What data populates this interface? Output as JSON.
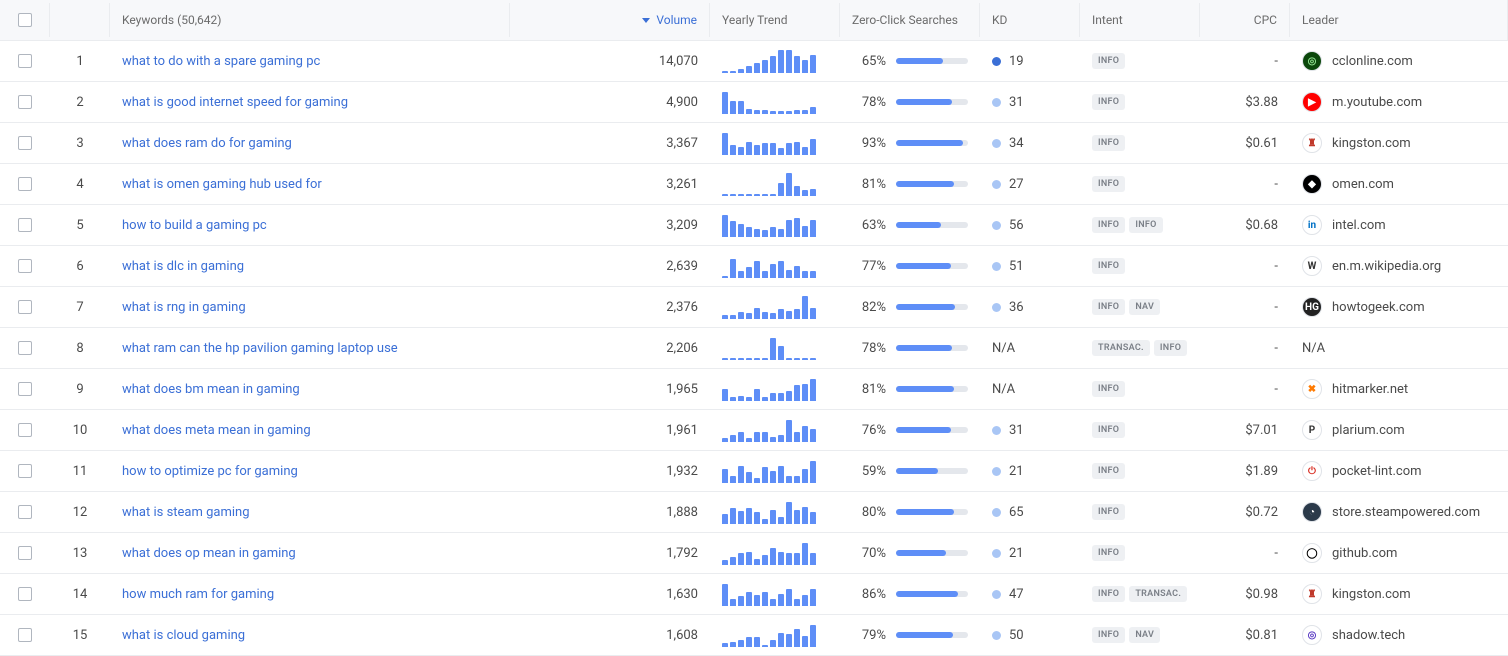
{
  "header": {
    "keywords_label": "Keywords (50,642)",
    "volume_label": "Volume",
    "trend_label": "Yearly Trend",
    "zeroclick_label": "Zero-Click Searches",
    "kd_label": "KD",
    "intent_label": "Intent",
    "cpc_label": "CPC",
    "leader_label": "Leader"
  },
  "rows": [
    {
      "idx": "1",
      "keyword": "what to do with a spare gaming pc",
      "volume": "14,070",
      "trend": [
        10,
        10,
        15,
        30,
        40,
        55,
        70,
        95,
        95,
        70,
        55,
        75
      ],
      "zc_pct": "65%",
      "zc_val": 65,
      "kd": "19",
      "kd_color": "#3b6fd6",
      "intent": [
        "INFO"
      ],
      "cpc": "-",
      "leader": "cclonline.com",
      "fav_bg": "#0b470b",
      "fav_fg": "#8fe08f",
      "fav_txt": "◎"
    },
    {
      "idx": "2",
      "keyword": "what is good internet speed for gaming",
      "volume": "4,900",
      "trend": [
        90,
        55,
        55,
        20,
        15,
        15,
        12,
        12,
        12,
        15,
        15,
        30
      ],
      "zc_pct": "78%",
      "zc_val": 78,
      "kd": "31",
      "kd_color": "#a9c6f5",
      "intent": [
        "INFO"
      ],
      "cpc": "$3.88",
      "leader": "m.youtube.com",
      "fav_bg": "#ff0000",
      "fav_fg": "#fff",
      "fav_txt": "▶"
    },
    {
      "idx": "3",
      "keyword": "what does ram do for gaming",
      "volume": "3,367",
      "trend": [
        90,
        40,
        35,
        55,
        40,
        50,
        50,
        30,
        50,
        55,
        35,
        65
      ],
      "zc_pct": "93%",
      "zc_val": 93,
      "kd": "34",
      "kd_color": "#a9c6f5",
      "intent": [
        "INFO"
      ],
      "cpc": "$0.61",
      "leader": "kingston.com",
      "fav_bg": "#fff",
      "fav_fg": "#c0392b",
      "fav_txt": "♜"
    },
    {
      "idx": "4",
      "keyword": "what is omen gaming hub used for",
      "volume": "3,261",
      "trend": [
        5,
        5,
        5,
        5,
        5,
        8,
        10,
        55,
        95,
        40,
        25,
        30
      ],
      "zc_pct": "81%",
      "zc_val": 81,
      "kd": "27",
      "kd_color": "#a9c6f5",
      "intent": [
        "INFO"
      ],
      "cpc": "-",
      "leader": "omen.com",
      "fav_bg": "#000",
      "fav_fg": "#fff",
      "fav_txt": "◆"
    },
    {
      "idx": "5",
      "keyword": "how to build a gaming pc",
      "volume": "3,209",
      "trend": [
        90,
        65,
        55,
        40,
        35,
        30,
        40,
        35,
        70,
        80,
        45,
        70
      ],
      "zc_pct": "63%",
      "zc_val": 63,
      "kd": "56",
      "kd_color": "#a9c6f5",
      "intent": [
        "INFO",
        "INFO"
      ],
      "cpc": "$0.68",
      "leader": "intel.com",
      "fav_bg": "#fff",
      "fav_fg": "#0071c5",
      "fav_txt": "in"
    },
    {
      "idx": "6",
      "keyword": "what is dlc in gaming",
      "volume": "2,639",
      "trend": [
        10,
        80,
        30,
        45,
        70,
        30,
        60,
        70,
        35,
        50,
        30,
        30
      ],
      "zc_pct": "77%",
      "zc_val": 77,
      "kd": "51",
      "kd_color": "#a9c6f5",
      "intent": [
        "INFO"
      ],
      "cpc": "-",
      "leader": "en.m.wikipedia.org",
      "fav_bg": "#fff",
      "fav_fg": "#333",
      "fav_txt": "W"
    },
    {
      "idx": "7",
      "keyword": "what is rng in gaming",
      "volume": "2,376",
      "trend": [
        15,
        15,
        30,
        25,
        45,
        30,
        25,
        40,
        35,
        40,
        95,
        45
      ],
      "zc_pct": "82%",
      "zc_val": 82,
      "kd": "36",
      "kd_color": "#a9c6f5",
      "intent": [
        "INFO",
        "NAV"
      ],
      "cpc": "-",
      "leader": "howtogeek.com",
      "fav_bg": "#222",
      "fav_fg": "#fff",
      "fav_txt": "HG"
    },
    {
      "idx": "8",
      "keyword": "what ram can the hp pavilion gaming laptop use",
      "volume": "2,206",
      "trend": [
        8,
        8,
        8,
        8,
        8,
        10,
        90,
        60,
        10,
        10,
        8,
        8
      ],
      "zc_pct": "78%",
      "zc_val": 78,
      "kd": "N/A",
      "kd_color": "",
      "intent": [
        "TRANSAC.",
        "INFO"
      ],
      "cpc": "-",
      "leader": "N/A",
      "fav_bg": "",
      "fav_fg": "",
      "fav_txt": ""
    },
    {
      "idx": "9",
      "keyword": "what does bm mean in gaming",
      "volume": "1,965",
      "trend": [
        50,
        15,
        20,
        15,
        50,
        15,
        35,
        35,
        40,
        65,
        70,
        90
      ],
      "zc_pct": "81%",
      "zc_val": 81,
      "kd": "N/A",
      "kd_color": "",
      "intent": [
        "INFO"
      ],
      "cpc": "-",
      "leader": "hitmarker.net",
      "fav_bg": "#fff",
      "fav_fg": "#ff7a00",
      "fav_txt": "✖"
    },
    {
      "idx": "10",
      "keyword": "what does meta mean in gaming",
      "volume": "1,961",
      "trend": [
        15,
        30,
        40,
        15,
        40,
        40,
        20,
        30,
        90,
        40,
        65,
        55
      ],
      "zc_pct": "76%",
      "zc_val": 76,
      "kd": "31",
      "kd_color": "#a9c6f5",
      "intent": [
        "INFO"
      ],
      "cpc": "$7.01",
      "leader": "plarium.com",
      "fav_bg": "#fff",
      "fav_fg": "#333",
      "fav_txt": "P"
    },
    {
      "idx": "11",
      "keyword": "how to optimize pc for gaming",
      "volume": "1,932",
      "trend": [
        60,
        30,
        70,
        45,
        20,
        65,
        50,
        70,
        30,
        30,
        60,
        90
      ],
      "zc_pct": "59%",
      "zc_val": 59,
      "kd": "21",
      "kd_color": "#a9c6f5",
      "intent": [
        "INFO"
      ],
      "cpc": "$1.89",
      "leader": "pocket-lint.com",
      "fav_bg": "#fff",
      "fav_fg": "#d93025",
      "fav_txt": "⏻"
    },
    {
      "idx": "12",
      "keyword": "what is steam gaming",
      "volume": "1,888",
      "trend": [
        40,
        65,
        55,
        65,
        50,
        20,
        60,
        30,
        90,
        60,
        70,
        50
      ],
      "zc_pct": "80%",
      "zc_val": 80,
      "kd": "65",
      "kd_color": "#a9c6f5",
      "intent": [
        "INFO"
      ],
      "cpc": "$0.72",
      "leader": "store.steampowered.com",
      "fav_bg": "#2b3a4a",
      "fav_fg": "#fff",
      "fav_txt": "◔"
    },
    {
      "idx": "13",
      "keyword": "what does op mean in gaming",
      "volume": "1,792",
      "trend": [
        20,
        35,
        50,
        55,
        25,
        40,
        70,
        55,
        50,
        50,
        90,
        50
      ],
      "zc_pct": "70%",
      "zc_val": 70,
      "kd": "21",
      "kd_color": "#a9c6f5",
      "intent": [
        "INFO"
      ],
      "cpc": "-",
      "leader": "github.com",
      "fav_bg": "#fff",
      "fav_fg": "#000",
      "fav_txt": "◯"
    },
    {
      "idx": "14",
      "keyword": "how much ram for gaming",
      "volume": "1,630",
      "trend": [
        90,
        30,
        40,
        60,
        45,
        60,
        30,
        50,
        70,
        30,
        45,
        70
      ],
      "zc_pct": "86%",
      "zc_val": 86,
      "kd": "47",
      "kd_color": "#a9c6f5",
      "intent": [
        "INFO",
        "TRANSAC."
      ],
      "cpc": "$0.98",
      "leader": "kingston.com",
      "fav_bg": "#fff",
      "fav_fg": "#c0392b",
      "fav_txt": "♜"
    },
    {
      "idx": "15",
      "keyword": "what is cloud gaming",
      "volume": "1,608",
      "trend": [
        15,
        20,
        30,
        40,
        40,
        10,
        30,
        60,
        55,
        75,
        45,
        90
      ],
      "zc_pct": "79%",
      "zc_val": 79,
      "kd": "50",
      "kd_color": "#a9c6f5",
      "intent": [
        "INFO",
        "NAV"
      ],
      "cpc": "$0.81",
      "leader": "shadow.tech",
      "fav_bg": "#fff",
      "fav_fg": "#5b3cc4",
      "fav_txt": "◎"
    }
  ]
}
